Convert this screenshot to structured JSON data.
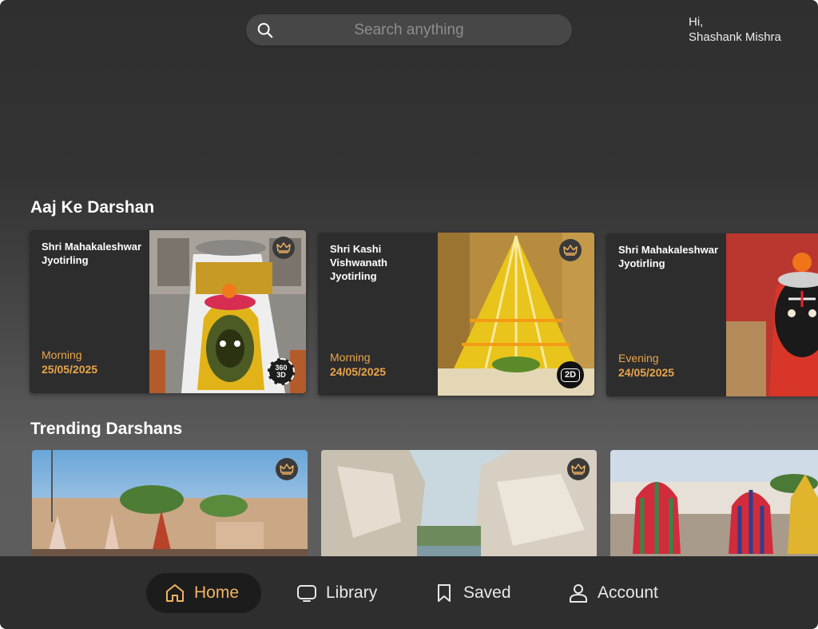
{
  "search": {
    "placeholder": "Search anything",
    "icon": "search-icon"
  },
  "user": {
    "greeting": "Hi,",
    "name": "Shashank Mishra"
  },
  "sections": {
    "aaj_ke_darshan": {
      "title": "Aaj Ke Darshan"
    },
    "trending": {
      "title": "Trending Darshans"
    }
  },
  "darshan_cards": [
    {
      "name": "Shri Mahakaleshwar Jyotirling",
      "time": "Morning",
      "date": "25/05/2025",
      "badge_line1": "360",
      "badge_line2": "3D",
      "premium": true
    },
    {
      "name": "Shri Kashi Vishwanath Jyotirling",
      "time": "Morning",
      "date": "24/05/2025",
      "badge_line1": "2D",
      "badge_line2": "",
      "premium": true
    },
    {
      "name": "Shri Mahakaleshwar Jyotirling",
      "time": "Evening",
      "date": "24/05/2025",
      "badge_line1": "",
      "badge_line2": "",
      "premium": false
    }
  ],
  "nav": {
    "home": "Home",
    "library": "Library",
    "saved": "Saved",
    "account": "Account"
  },
  "colors": {
    "accent": "#e9a54a",
    "active_nav": "#f0b561",
    "card_bg": "#2d2d2d"
  }
}
